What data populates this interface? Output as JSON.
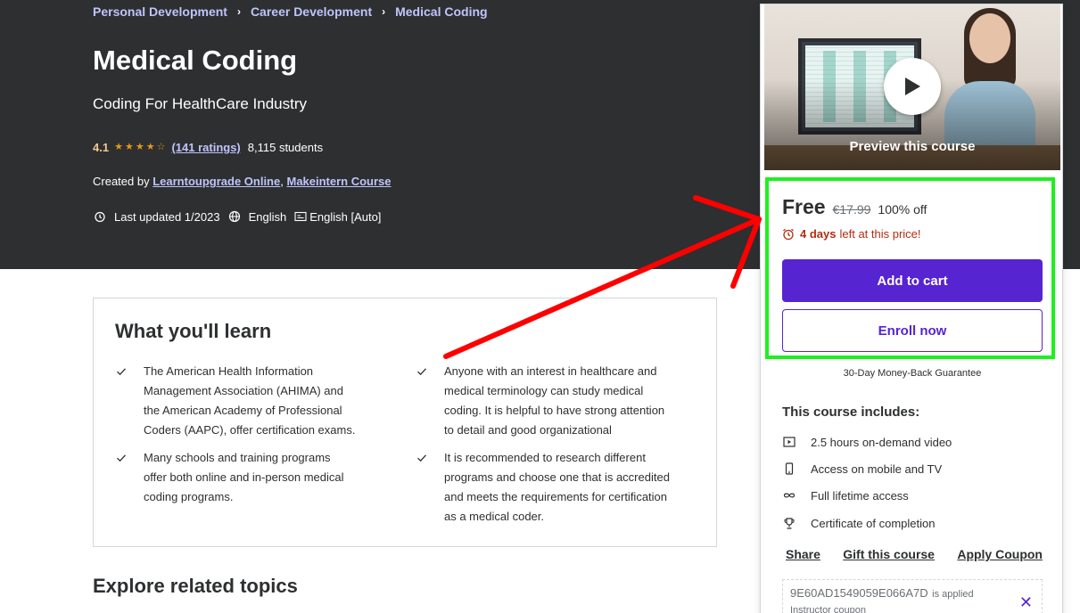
{
  "breadcrumb": {
    "items": [
      "Personal Development",
      "Career Development",
      "Medical Coding"
    ]
  },
  "course": {
    "title": "Medical Coding",
    "subtitle": "Coding For HealthCare Industry",
    "rating": "4.1",
    "rating_value": 4.1,
    "ratings_count": "(141 ratings)",
    "students": "8,115 students",
    "created_by_label": "Created by",
    "instructors": [
      "Learntoupgrade Online",
      "Makeintern Course"
    ],
    "instructor_sep": ",",
    "last_updated": "Last updated 1/2023",
    "language": "English",
    "captions": "English [Auto]"
  },
  "learn": {
    "title": "What you'll learn",
    "items": [
      "The American Health Information Management Association (AHIMA) and the American Academy of Professional Coders (AAPC), offer certification exams.",
      "Anyone with an interest in healthcare and medical terminology can study medical coding. It is helpful to have strong attention to detail and good organizational",
      "Many schools and training programs offer both online and in-person medical coding programs.",
      "It is recommended to research different programs and choose one that is accredited and meets the requirements for certification as a medical coder."
    ]
  },
  "explore": {
    "title": "Explore related topics"
  },
  "sidebar": {
    "preview_label": "Preview this course",
    "price": "Free",
    "original_price": "€17.99",
    "discount": "100% off",
    "timer_bold": "4 days",
    "timer_rest": "left at this price!",
    "add_to_cart": "Add to cart",
    "enroll_now": "Enroll now",
    "guarantee": "30-Day Money-Back Guarantee",
    "includes_title": "This course includes:",
    "includes": [
      {
        "icon": "video-icon",
        "label": "2.5 hours on-demand video"
      },
      {
        "icon": "mobile-icon",
        "label": "Access on mobile and TV"
      },
      {
        "icon": "infinity-icon",
        "label": "Full lifetime access"
      },
      {
        "icon": "trophy-icon",
        "label": "Certificate of completion"
      }
    ],
    "links": {
      "share": "Share",
      "gift": "Gift this course",
      "coupon": "Apply Coupon"
    },
    "coupon": {
      "code": "9E60AD1549059E066A7D",
      "applied": "is applied",
      "type": "Instructor coupon"
    }
  },
  "colors": {
    "hero_bg": "#2d2f31",
    "brand_purple": "#5624d0",
    "link_lavender": "#c0c4fc",
    "rating_gold": "#e59819",
    "annotation_green": "#1ef01e",
    "annotation_red": "#ff0000",
    "timer_red": "#b32d0f"
  }
}
